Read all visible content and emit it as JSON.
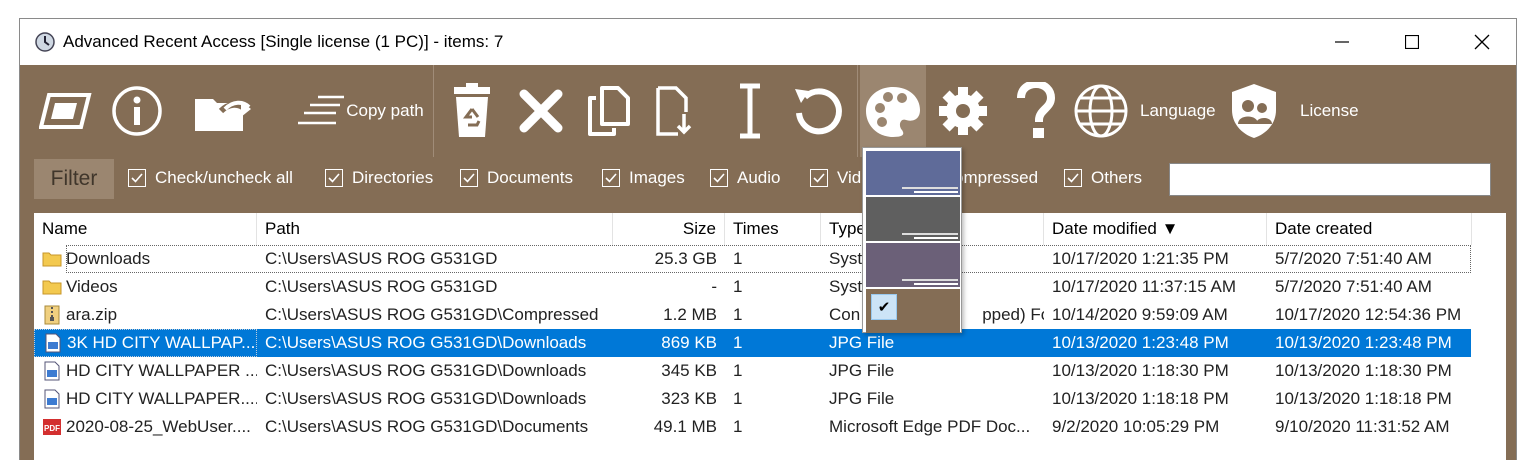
{
  "window": {
    "title": "Advanced Recent Access [Single license (1 PC)] - items: 7"
  },
  "toolbar": {
    "copy_path_label": "Copy path",
    "language_label": "Language",
    "license_label": "License"
  },
  "filter": {
    "label": "Filter",
    "checkboxes": [
      {
        "label": "Check/uncheck all",
        "checked": true
      },
      {
        "label": "Directories",
        "checked": true
      },
      {
        "label": "Documents",
        "checked": true
      },
      {
        "label": "Images",
        "checked": true
      },
      {
        "label": "Audio",
        "checked": true
      },
      {
        "label": "Vid",
        "checked": true
      },
      {
        "label": "ompressed",
        "checked": true
      },
      {
        "label": "Others",
        "checked": true
      }
    ],
    "search_value": ""
  },
  "columns": [
    "Name",
    "Path",
    "Size",
    "Times",
    "Type",
    "Date modified ▼",
    "Date created"
  ],
  "rows": [
    {
      "name": "Downloads",
      "path": "C:\\Users\\ASUS ROG G531GD",
      "size": "25.3 GB",
      "times": "1",
      "type": "Syst",
      "modified": "10/17/2020 1:21:35 PM",
      "created": "5/7/2020 7:51:40 AM",
      "icon": "folder-icon"
    },
    {
      "name": "Videos",
      "path": "C:\\Users\\ASUS ROG G531GD",
      "size": "-",
      "times": "1",
      "type": "Syst",
      "modified": "10/17/2020 11:37:15 AM",
      "created": "5/7/2020 7:51:40 AM",
      "icon": "folder-icon"
    },
    {
      "name": "ara.zip",
      "path": "C:\\Users\\ASUS ROG G531GD\\Compressed",
      "size": "1.2 MB",
      "times": "1",
      "type": "Con",
      "type_tail": "pped) Fo...",
      "modified": "10/14/2020 9:59:09 AM",
      "created": "10/17/2020 12:54:36 PM",
      "icon": "zip-icon"
    },
    {
      "name": "3K HD CITY WALLPAP...",
      "path": "C:\\Users\\ASUS ROG G531GD\\Downloads",
      "size": "869 KB",
      "times": "1",
      "type": "JPG File",
      "modified": "10/13/2020 1:23:48 PM",
      "created": "10/13/2020 1:23:48 PM",
      "icon": "image-file-icon",
      "selected": true
    },
    {
      "name": "HD CITY WALLPAPER ...",
      "path": "C:\\Users\\ASUS ROG G531GD\\Downloads",
      "size": "345 KB",
      "times": "1",
      "type": "JPG File",
      "modified": "10/13/2020 1:18:30 PM",
      "created": "10/13/2020 1:18:30 PM",
      "icon": "image-file-icon"
    },
    {
      "name": "HD CITY WALLPAPER....",
      "path": "C:\\Users\\ASUS ROG G531GD\\Downloads",
      "size": "323 KB",
      "times": "1",
      "type": "JPG File",
      "modified": "10/13/2020 1:18:18 PM",
      "created": "10/13/2020 1:18:18 PM",
      "icon": "image-file-icon"
    },
    {
      "name": "2020-08-25_WebUser....",
      "path": "C:\\Users\\ASUS ROG G531GD\\Documents",
      "size": "49.1 MB",
      "times": "1",
      "type": "Microsoft Edge PDF Doc...",
      "modified": "9/2/2020 10:05:29 PM",
      "created": "9/10/2020 11:31:52 AM",
      "icon": "pdf-icon"
    }
  ],
  "theme_dropdown": {
    "swatches": [
      "#5f6b99",
      "#5f5f5f",
      "#6b6078",
      "#846d55"
    ],
    "selected_index": 3
  },
  "colors": {
    "toolbar_bg": "#846d55",
    "selection": "#0078d7"
  }
}
